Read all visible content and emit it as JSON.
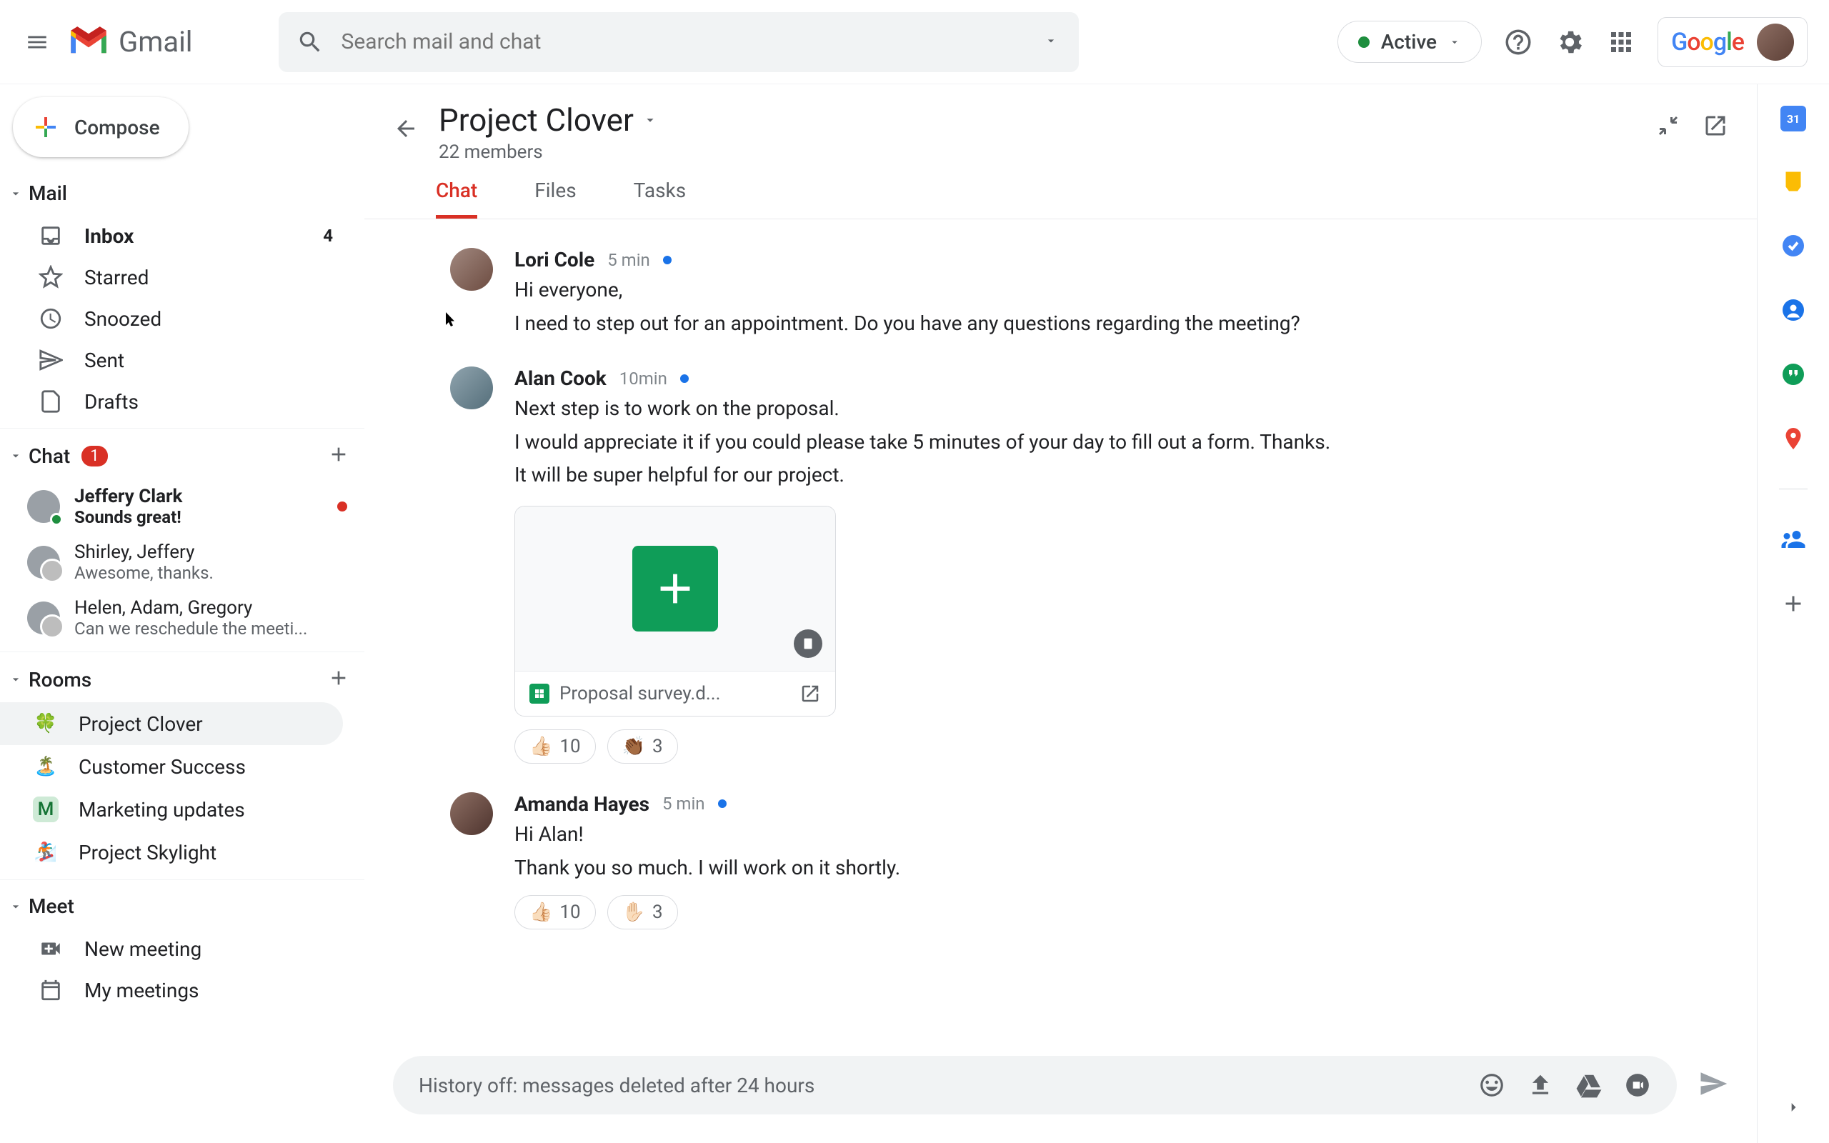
{
  "header": {
    "product": "Gmail",
    "search_placeholder": "Search mail and chat",
    "status": "Active"
  },
  "compose": "Compose",
  "sections": {
    "mail": {
      "label": "Mail",
      "items": [
        {
          "label": "Inbox",
          "count": "4",
          "bold": true
        },
        {
          "label": "Starred"
        },
        {
          "label": "Snoozed"
        },
        {
          "label": "Sent"
        },
        {
          "label": "Drafts"
        }
      ]
    },
    "chat": {
      "label": "Chat",
      "badge": "1",
      "items": [
        {
          "name": "Jeffery Clark",
          "preview": "Sounds great!",
          "bold": true,
          "unread": true,
          "presence": true
        },
        {
          "name": "Shirley, Jeffery",
          "preview": "Awesome, thanks.",
          "group": true
        },
        {
          "name": "Helen, Adam, Gregory",
          "preview": "Can we reschedule the meeti...",
          "group": true
        }
      ]
    },
    "rooms": {
      "label": "Rooms",
      "items": [
        {
          "icon": "🍀",
          "label": "Project Clover",
          "active": true
        },
        {
          "icon": "🏝️",
          "label": "Customer Success"
        },
        {
          "icon": "M",
          "label": "Marketing updates",
          "bg": "#ceead6",
          "color": "#137333"
        },
        {
          "icon": "🏂",
          "label": "Project Skylight"
        }
      ]
    },
    "meet": {
      "label": "Meet",
      "items": [
        {
          "label": "New meeting"
        },
        {
          "label": "My meetings"
        }
      ]
    }
  },
  "room": {
    "title": "Project Clover",
    "members": "22 members",
    "tabs": [
      "Chat",
      "Files",
      "Tasks"
    ],
    "messages": [
      {
        "name": "Lori Cole",
        "time": "5 min",
        "lines": [
          "Hi everyone,",
          "I need to step out for an appointment. Do you have any questions regarding the meeting?"
        ]
      },
      {
        "name": "Alan Cook",
        "time": "10min",
        "lines": [
          "Next step is to work on the proposal.",
          "I would appreciate it if you could please take 5 minutes of your day to fill out a form. Thanks.",
          "It will be super helpful for our project."
        ],
        "attachment": {
          "filename": "Proposal survey.d..."
        },
        "reactions": [
          {
            "emoji": "👍🏻",
            "count": "10"
          },
          {
            "emoji": "👏🏾",
            "count": "3"
          }
        ]
      },
      {
        "name": "Amanda Hayes",
        "time": "5 min",
        "lines": [
          "Hi Alan!",
          "Thank you so much. I will work on it shortly."
        ],
        "reactions": [
          {
            "emoji": "👍🏻",
            "count": "10"
          },
          {
            "emoji": "✋🏻",
            "count": "3"
          }
        ]
      }
    ],
    "composer_placeholder": "History off: messages deleted after 24 hours"
  },
  "sidepanel_cal": "31"
}
